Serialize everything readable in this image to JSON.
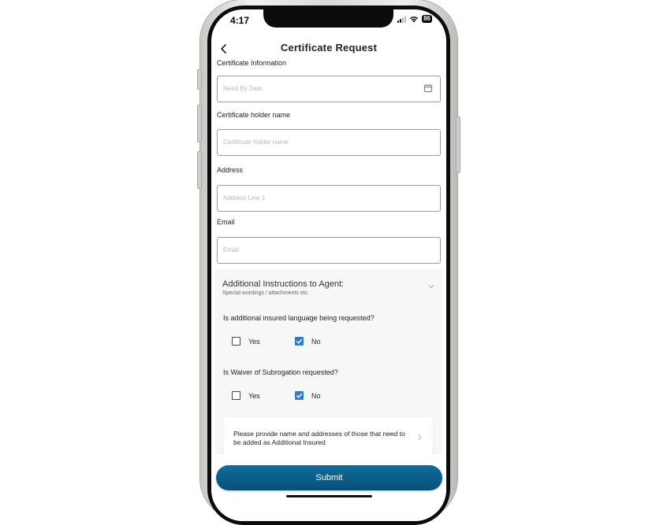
{
  "status_bar": {
    "time": "4:17",
    "battery": "86"
  },
  "header": {
    "title": "Certificate Request"
  },
  "form": {
    "section_certificate_info": "Certificate Information",
    "need_by_date_placeholder": "Need By Date",
    "holder_label": "Certificate holder name",
    "holder_placeholder": "Certificate holder name",
    "address_label": "Address",
    "address_placeholder": "Address Line 1",
    "email_label": "Email",
    "email_placeholder": "Email"
  },
  "instructions": {
    "title": "Additional Instructions to Agent:",
    "subtitle": "Special wordings / attachments etc.",
    "q1": {
      "text": "Is additional insured language being requested?",
      "yes_label": "Yes",
      "no_label": "No",
      "yes_checked": false,
      "no_checked": true
    },
    "q2": {
      "text": "Is Waiver of Subrogation requested?",
      "yes_label": "Yes",
      "no_label": "No",
      "yes_checked": false,
      "no_checked": true
    },
    "insured_card_text": "Please provide name and addresses of those that need to be added as Additional Insured"
  },
  "footer": {
    "submit_label": "Submit"
  },
  "colors": {
    "accent": "#0a5a86",
    "checkbox": "#2f7bd0"
  }
}
